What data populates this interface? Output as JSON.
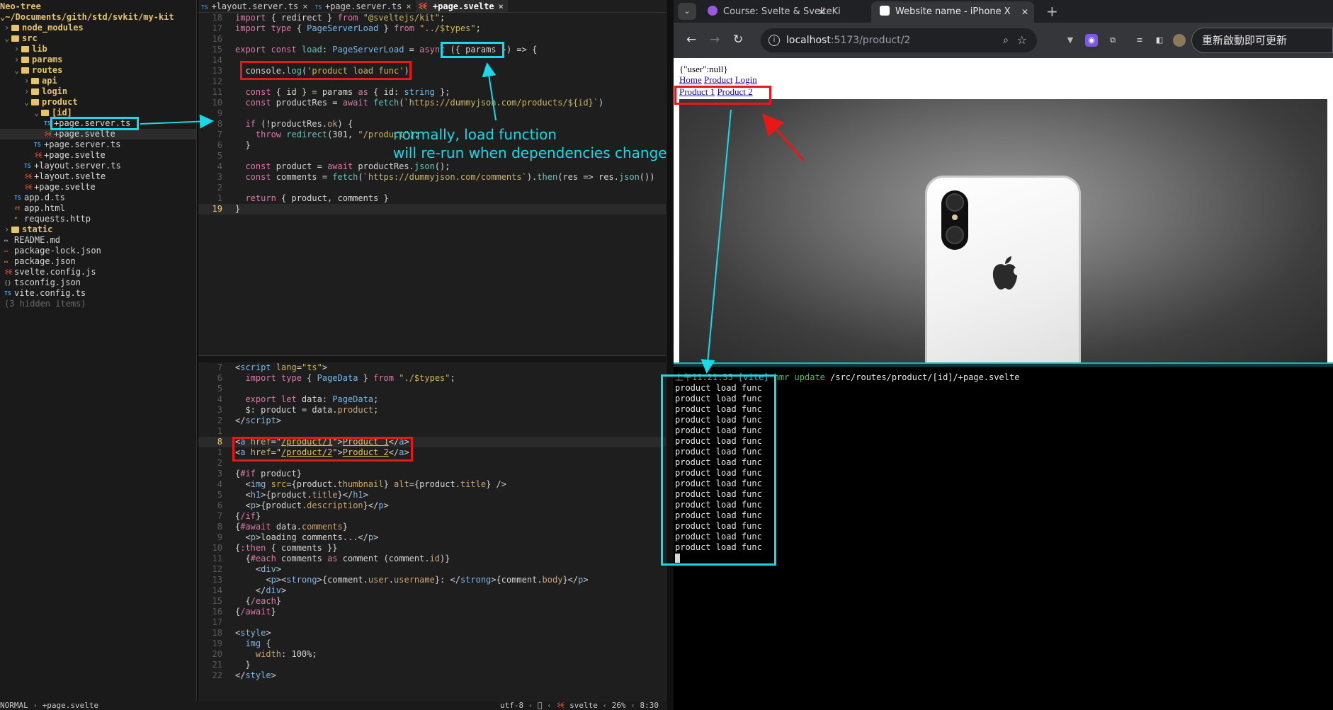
{
  "neotree": {
    "header": "Neo-tree",
    "root": "~/Documents/gith/std/svkit/my-kit",
    "items": [
      {
        "label": "node_modules",
        "type": "dir",
        "depth": 1,
        "chev": "›"
      },
      {
        "label": "src",
        "type": "dir",
        "depth": 1,
        "chev": "⌄"
      },
      {
        "label": "lib",
        "type": "dir",
        "depth": 2,
        "chev": "›"
      },
      {
        "label": "params",
        "type": "dir",
        "depth": 2,
        "chev": "›"
      },
      {
        "label": "routes",
        "type": "dir",
        "depth": 2,
        "chev": "⌄"
      },
      {
        "label": "api",
        "type": "dir",
        "depth": 3,
        "chev": "›"
      },
      {
        "label": "login",
        "type": "dir",
        "depth": 3,
        "chev": "›"
      },
      {
        "label": "product",
        "type": "dir",
        "depth": 3,
        "chev": "⌄"
      },
      {
        "label": "[id]",
        "type": "dir",
        "depth": 4,
        "chev": "⌄"
      },
      {
        "label": "+page.server.ts",
        "type": "ts",
        "depth": 5
      },
      {
        "label": "+page.svelte",
        "type": "svelte",
        "depth": 5
      },
      {
        "label": "+page.server.ts",
        "type": "ts",
        "depth": 4
      },
      {
        "label": "+page.svelte",
        "type": "svelte",
        "depth": 4
      },
      {
        "label": "+layout.server.ts",
        "type": "ts",
        "depth": 3
      },
      {
        "label": "+layout.svelte",
        "type": "svelte",
        "depth": 3
      },
      {
        "label": "+page.svelte",
        "type": "svelte",
        "depth": 3
      },
      {
        "label": "app.d.ts",
        "type": "ts",
        "depth": 2
      },
      {
        "label": "app.html",
        "type": "html",
        "depth": 2
      },
      {
        "label": "requests.http",
        "type": "http",
        "depth": 2
      },
      {
        "label": "static",
        "type": "dir",
        "depth": 1,
        "chev": "›"
      },
      {
        "label": "README.md",
        "type": "md",
        "depth": 1
      },
      {
        "label": "package-lock.json",
        "type": "lock",
        "depth": 1
      },
      {
        "label": "package.json",
        "type": "json",
        "depth": 1
      },
      {
        "label": "svelte.config.js",
        "type": "svelte",
        "depth": 1
      },
      {
        "label": "tsconfig.json",
        "type": "cog",
        "depth": 1
      },
      {
        "label": "vite.config.ts",
        "type": "ts",
        "depth": 1
      },
      {
        "label": "(3 hidden items)",
        "type": "hidden",
        "depth": 1
      }
    ]
  },
  "editor": {
    "tabs": [
      {
        "icon": "TS",
        "label": "+layout.server.ts",
        "close": "󰅖"
      },
      {
        "icon": "TS",
        "label": "+page.server.ts",
        "close": "󰅖"
      },
      {
        "icon": "svelte",
        "label": "+page.svelte",
        "close": "󰅖",
        "active": true
      }
    ],
    "top_lines": [
      {
        "n": "18",
        "html": "<span class=\"kw\">import</span> { redirect } <span class=\"kw\">from</span> <span class=\"str\">\"@sveltejs/kit\"</span>;"
      },
      {
        "n": "17",
        "html": "<span class=\"kw\">import type</span> { <span class=\"ty\">PageServerLoad</span> } <span class=\"kw\">from</span> <span class=\"str\">\"../$types\"</span>;"
      },
      {
        "n": "16",
        "html": ""
      },
      {
        "n": "15",
        "html": "<span class=\"kw\">export const</span> <span class=\"fn\">load</span>: <span class=\"ty\">PageServerLoad</span> = <span class=\"kw\">async</span> ({ params }) =&gt; {"
      },
      {
        "n": "14",
        "html": ""
      },
      {
        "n": "13",
        "html": "  console.<span class=\"fn\">log</span>(<span class=\"str\">'product load func'</span>)"
      },
      {
        "n": "12",
        "html": ""
      },
      {
        "n": "11",
        "html": "  <span class=\"kw\">const</span> { id } = params <span class=\"kw\">as</span> { id: <span class=\"ty\">string</span> };"
      },
      {
        "n": "10",
        "html": "  <span class=\"kw\">const</span> productRes = <span class=\"kw\">await</span> <span class=\"fn\">fetch</span>(<span class=\"str\">`https://dummyjson.com/products/${id}`</span>)"
      },
      {
        "n": "9",
        "html": ""
      },
      {
        "n": "8",
        "html": "  <span class=\"kw\">if</span> (!productRes.<span class=\"pr\">ok</span>) {"
      },
      {
        "n": "7",
        "html": "    <span class=\"kw\">throw</span> <span class=\"fn\">redirect</span>(301, <span class=\"str\">\"/product\"</span>);"
      },
      {
        "n": "6",
        "html": "  }"
      },
      {
        "n": "5",
        "html": ""
      },
      {
        "n": "4",
        "html": "  <span class=\"kw\">const</span> product = <span class=\"kw\">await</span> productRes.<span class=\"fn\">json</span>();"
      },
      {
        "n": "3",
        "html": "  <span class=\"kw\">const</span> comments = <span class=\"fn\">fetch</span>(<span class=\"str\">`https://dummyjson.com/comments`</span>).<span class=\"fn\">then</span>(res =&gt; res.<span class=\"fn\">json</span>())"
      },
      {
        "n": "2",
        "html": ""
      },
      {
        "n": "1",
        "html": "  <span class=\"kw\">return</span> { product, comments }"
      },
      {
        "n": "19",
        "html": "}",
        "current": true
      }
    ],
    "bottom_lines": [
      {
        "n": "7",
        "html": "&lt;<span class=\"tag\">script</span> <span class=\"attr\">lang</span>=<span class=\"str\">\"ts\"</span>&gt;"
      },
      {
        "n": "6",
        "html": "  <span class=\"kw\">import type</span> { <span class=\"ty\">PageData</span> } <span class=\"kw\">from</span> <span class=\"str\">\"./$types\"</span>;"
      },
      {
        "n": "5",
        "html": ""
      },
      {
        "n": "4",
        "html": "  <span class=\"kw\">export let</span> data: <span class=\"ty\">PageData</span>;"
      },
      {
        "n": "3",
        "html": "  $: product = data.<span class=\"pr\">product</span>;"
      },
      {
        "n": "2",
        "html": "&lt;/<span class=\"tag\">script</span>&gt;"
      },
      {
        "n": "1",
        "html": ""
      },
      {
        "n": "8",
        "html": "&lt;<span class=\"tag\">a</span> <span class=\"attr\">href</span>=\"<span class=\"lnk\">/product/1</span>\"&gt;<span class=\"lnk\">Product 1</span>&lt;/<span class=\"tag\">a</span>&gt;",
        "current": true
      },
      {
        "n": "1",
        "html": "&lt;<span class=\"tag\">a</span> <span class=\"attr\">href</span>=\"<span class=\"lnk\">/product/2</span>\"&gt;<span class=\"lnk\">Product 2</span>&lt;/<span class=\"tag\">a</span>&gt;"
      },
      {
        "n": "2",
        "html": ""
      },
      {
        "n": "3",
        "html": "{<span class=\"kw\">#if</span> product}"
      },
      {
        "n": "4",
        "html": "  &lt;<span class=\"tag\">img</span> <span class=\"attr\">src</span>={product.<span class=\"pr\">thumbnail</span>} <span class=\"attr\">alt</span>={product.<span class=\"pr\">title</span>} /&gt;"
      },
      {
        "n": "5",
        "html": "  &lt;<span class=\"tag\">h1</span>&gt;{product.<span class=\"pr\">title</span>}&lt;/<span class=\"tag\">h1</span>&gt;"
      },
      {
        "n": "6",
        "html": "  &lt;<span class=\"tag\">p</span>&gt;{product.<span class=\"pr\">description</span>}&lt;/<span class=\"tag\">p</span>&gt;"
      },
      {
        "n": "7",
        "html": "{<span class=\"kw\">/if</span>}"
      },
      {
        "n": "8",
        "html": "{<span class=\"kw\">#await</span> data.<span class=\"pr\">comments</span>}"
      },
      {
        "n": "9",
        "html": "  &lt;<span class=\"tag\">p</span>&gt;loading comments...&lt;/<span class=\"tag\">p</span>&gt;"
      },
      {
        "n": "10",
        "html": "{<span class=\"kw\">:then</span> { comments }}"
      },
      {
        "n": "11",
        "html": "  {<span class=\"kw\">#each</span> comments <span class=\"kw\">as</span> comment (comment.<span class=\"pr\">id</span>)}"
      },
      {
        "n": "12",
        "html": "    &lt;<span class=\"tag\">div</span>&gt;"
      },
      {
        "n": "13",
        "html": "      &lt;<span class=\"tag\">p</span>&gt;&lt;<span class=\"tag\">strong</span>&gt;{comment.<span class=\"pr\">user</span>.<span class=\"pr\">username</span>}: &lt;/<span class=\"tag\">strong</span>&gt;{comment.<span class=\"pr\">body</span>}&lt;/<span class=\"tag\">p</span>&gt;"
      },
      {
        "n": "14",
        "html": "    &lt;/<span class=\"tag\">div</span>&gt;"
      },
      {
        "n": "15",
        "html": "  {<span class=\"kw\">/each</span>}"
      },
      {
        "n": "16",
        "html": "{<span class=\"kw\">/await</span>}"
      },
      {
        "n": "17",
        "html": ""
      },
      {
        "n": "18",
        "html": "&lt;<span class=\"tag\">style</span>&gt;"
      },
      {
        "n": "19",
        "html": "  <span class=\"tag\">img</span> {"
      },
      {
        "n": "20",
        "html": "    <span class=\"pr\">width</span>: 100%;"
      },
      {
        "n": "21",
        "html": "  }"
      },
      {
        "n": "22",
        "html": "&lt;/<span class=\"tag\">style</span>&gt;"
      }
    ]
  },
  "statusbar": {
    "mode": "NORMAL",
    "file": "+page.svelte",
    "encoding": "utf-8",
    "lineending": "󰌽",
    "filetype": "svelte",
    "percent": "26%",
    "position": "8:30"
  },
  "annotation": {
    "line1": "normally, load function",
    "line2": "will re-run when dependencies change"
  },
  "browser": {
    "tab1": "Course: Svelte & SvelteKi",
    "tab2": "Website name - iPhone X",
    "url_host": "localhost",
    "url_path": ":5173/product/2",
    "update_button": "重新啟動即可更新",
    "page": {
      "json_text": "{\"user\":null}",
      "nav": [
        "Home",
        "Product",
        "Login"
      ],
      "products": [
        "Product 1",
        "Product 2"
      ]
    }
  },
  "terminal": {
    "hmr_time": "上午11:21:35",
    "hmr_tag": "[vite]",
    "hmr_msg": "hmr update",
    "hmr_path": "/src/routes/product/[id]/+page.svelte",
    "lines": [
      "product load func",
      "product load func",
      "product load func",
      "product load func",
      "product load func",
      "product load func",
      "product load func",
      "product load func",
      "product load func",
      "product load func",
      "product load func",
      "product load func",
      "product load func",
      "product load func",
      "product load func",
      "product load func"
    ]
  },
  "colors": {
    "annotation_cyan": "#19d8e8",
    "annotation_red": "#e81818"
  }
}
